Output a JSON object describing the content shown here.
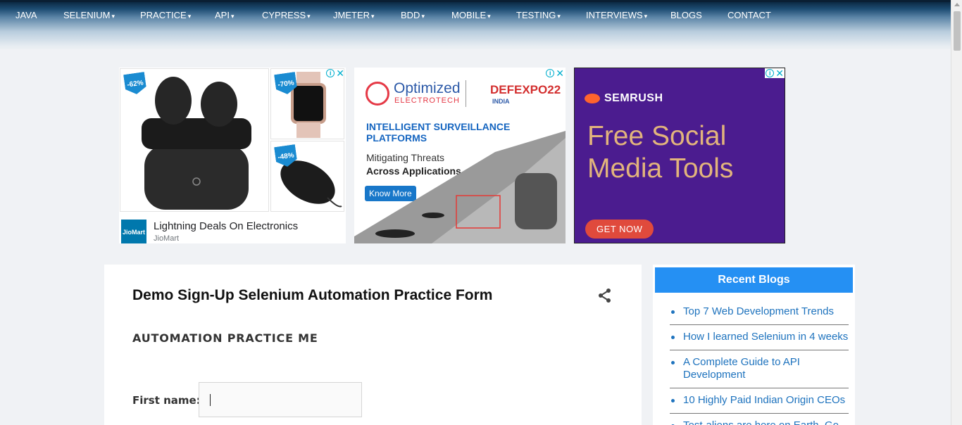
{
  "nav": {
    "items": [
      {
        "label": "JAVA",
        "has_caret": false
      },
      {
        "label": "SELENIUM",
        "has_caret": true
      },
      {
        "label": "PRACTICE",
        "has_caret": true
      },
      {
        "label": "API",
        "has_caret": true
      },
      {
        "label": "CYPRESS",
        "has_caret": true
      },
      {
        "label": "JMETER",
        "has_caret": true
      },
      {
        "label": "BDD",
        "has_caret": true
      },
      {
        "label": "MOBILE",
        "has_caret": true
      },
      {
        "label": "TESTING",
        "has_caret": true
      },
      {
        "label": "INTERVIEWS",
        "has_caret": true
      },
      {
        "label": "BLOGS",
        "has_caret": false
      },
      {
        "label": "CONTACT",
        "has_caret": false
      }
    ],
    "caret_glyph": "▾"
  },
  "ads": {
    "jiomart": {
      "badges": [
        "-62%",
        "-70%",
        "-48%"
      ],
      "title": "Lightning Deals On Electronics",
      "source": "JioMart",
      "logo_text": "JioMart"
    },
    "optimized": {
      "brand_line1": "Optimized",
      "brand_line2": "ELECTROTECH",
      "expo": "DEFEXPO22",
      "expo_sub": "INDIA",
      "headline": "INTELLIGENT SURVEILLANCE PLATFORMS",
      "line1": "Mitigating Threats",
      "line2": "Across Applications",
      "cta": "Know More"
    },
    "semrush": {
      "brand": "SEMRUSH",
      "headline": "Free Social Media Tools",
      "cta": "GET NOW"
    }
  },
  "main": {
    "title": "Demo Sign-Up Selenium Automation Practice Form",
    "subtitle": "AUTOMATION PRACTICE ME",
    "first_name_label": "First name:",
    "first_name_value": ""
  },
  "sidebar": {
    "heading": "Recent Blogs",
    "items": [
      "Top 7 Web Development Trends",
      "How I learned Selenium in 4 weeks",
      "A Complete Guide to API Development",
      "10 Highly Paid Indian Origin CEOs",
      "Test-aliens are here on Earth, Go"
    ]
  },
  "colors": {
    "accent": "#2590f3",
    "link": "#1e73be",
    "semrush_bg": "#4b1c8f"
  }
}
